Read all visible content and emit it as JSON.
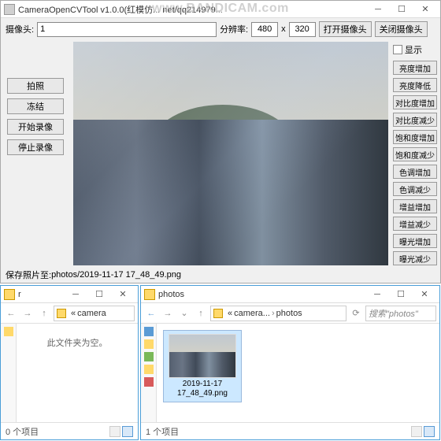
{
  "watermark": "www.BANDICAM.com",
  "mainWindow": {
    "title": "CameraOpenCVTool v1.0.0(红模仿... net/qq214979...",
    "toolbar": {
      "cameraLabel": "摄像头:",
      "cameraValue": "1",
      "resLabel": "分辨率:",
      "width": "480",
      "times": "x",
      "height": "320",
      "openBtn": "打开摄像头",
      "closeBtn": "关闭摄像头"
    },
    "leftButtons": [
      "拍照",
      "冻结",
      "开始录像",
      "停止录像"
    ],
    "rightPanel": {
      "showLabel": "显示",
      "buttons": [
        "亮度增加",
        "亮度降低",
        "对比度增加",
        "对比度减少",
        "饱和度增加",
        "饱和度减少",
        "色调增加",
        "色调减少",
        "增益增加",
        "增益减少",
        "曝光增加",
        "曝光减少"
      ]
    },
    "status": {
      "label": "保存照片至: ",
      "path": "photos/2019-11-17 17_48_49.png"
    }
  },
  "explorer1": {
    "title": "r",
    "breadcrumb": [
      "«",
      "camera"
    ],
    "empty": "此文件夹为空。",
    "status": "0 个项目"
  },
  "explorer2": {
    "title": "photos",
    "breadcrumb": [
      "«",
      "camera...",
      "photos"
    ],
    "searchPlaceholder": "搜索\"photos\"",
    "file": {
      "name": "2019-11-17 17_48_49.png"
    },
    "status": "1 个项目"
  }
}
